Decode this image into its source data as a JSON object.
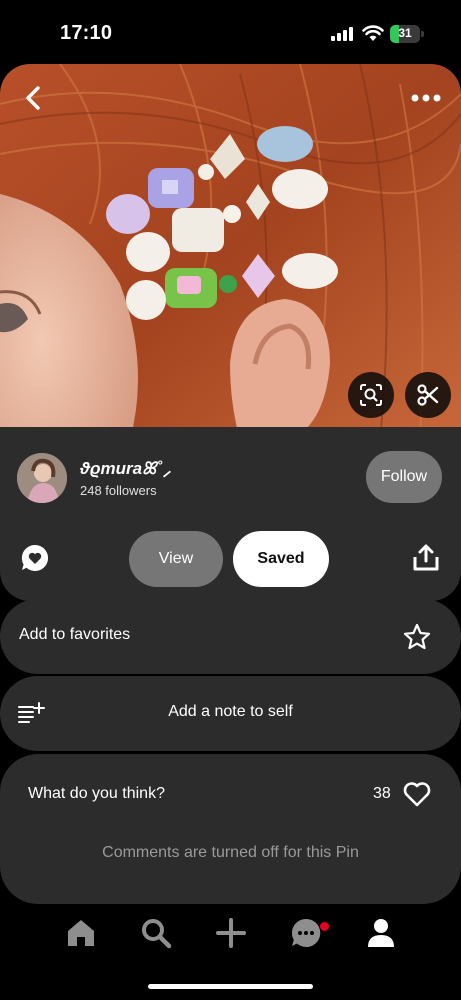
{
  "status_bar": {
    "time": "17:10",
    "battery_level": "31",
    "battery_fraction": 0.31,
    "icons": [
      "signal-icon",
      "wifi-icon",
      "battery-charging-icon"
    ]
  },
  "pin": {
    "image_subject": "photo",
    "icons": [
      "back-arrow-icon",
      "more-options-icon",
      "visual-search-icon",
      "scissors-icon"
    ]
  },
  "creator": {
    "name": "ϑϱmuraꕤ˚⸝",
    "followers": "248 followers",
    "follow_label": "Follow"
  },
  "actions": {
    "view_label": "View",
    "saved_label": "Saved",
    "icons": [
      "comment-heart-icon",
      "share-icon"
    ]
  },
  "favorites": {
    "label": "Add to favorites",
    "icon": "star-icon"
  },
  "note": {
    "label": "Add a note to self",
    "icon": "note-add-icon"
  },
  "comments": {
    "title": "What do you think?",
    "likes": "38",
    "disabled_text": "Comments are turned off for this Pin",
    "icon": "heart-icon"
  },
  "tab_bar": {
    "tabs": [
      "home-icon",
      "search-icon",
      "create-icon",
      "messages-icon",
      "profile-icon"
    ],
    "notification_color": "#e60023"
  },
  "colors": {
    "background": "#000000",
    "card": "#2c2c2c",
    "button_gray": "#767676",
    "battery_green": "#35c759"
  }
}
